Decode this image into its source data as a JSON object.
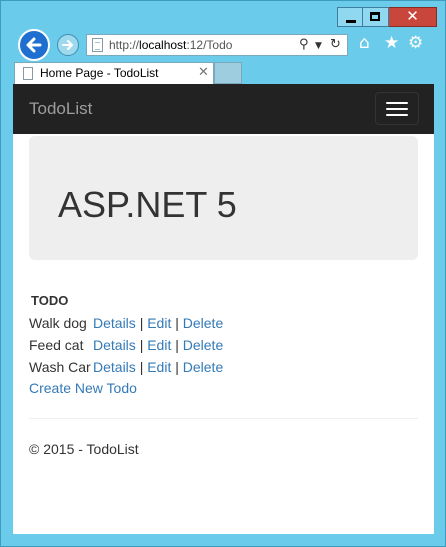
{
  "browser": {
    "url_prefix": "http://",
    "url_host": "localhost",
    "url_rest": ":12/Todo",
    "tab_title": "Home Page - TodoList",
    "icons": {
      "back": "back-arrow-icon",
      "forward": "forward-arrow-icon",
      "search": "search-icon",
      "refresh": "refresh-icon",
      "home": "home-icon",
      "favorites": "star-icon",
      "settings": "gear-icon"
    }
  },
  "navbar": {
    "brand": "TodoList"
  },
  "jumbotron": {
    "title": "ASP.NET 5"
  },
  "todo": {
    "heading": "TODO",
    "items": [
      {
        "name": "Walk dog",
        "details": "Details",
        "edit": "Edit",
        "delete": "Delete"
      },
      {
        "name": "Feed cat",
        "details": "Details",
        "edit": "Edit",
        "delete": "Delete"
      },
      {
        "name": "Wash Car",
        "details": "Details",
        "edit": "Edit",
        "delete": "Delete"
      }
    ],
    "separator": "|",
    "create_link": "Create New Todo"
  },
  "footer": {
    "text": "© 2015 - TodoList"
  },
  "colors": {
    "window_frame": "#6acbeb",
    "navbar_bg": "#222222",
    "link": "#337ab7",
    "jumbotron_bg": "#eeeeee",
    "close_button": "#c9463d"
  }
}
